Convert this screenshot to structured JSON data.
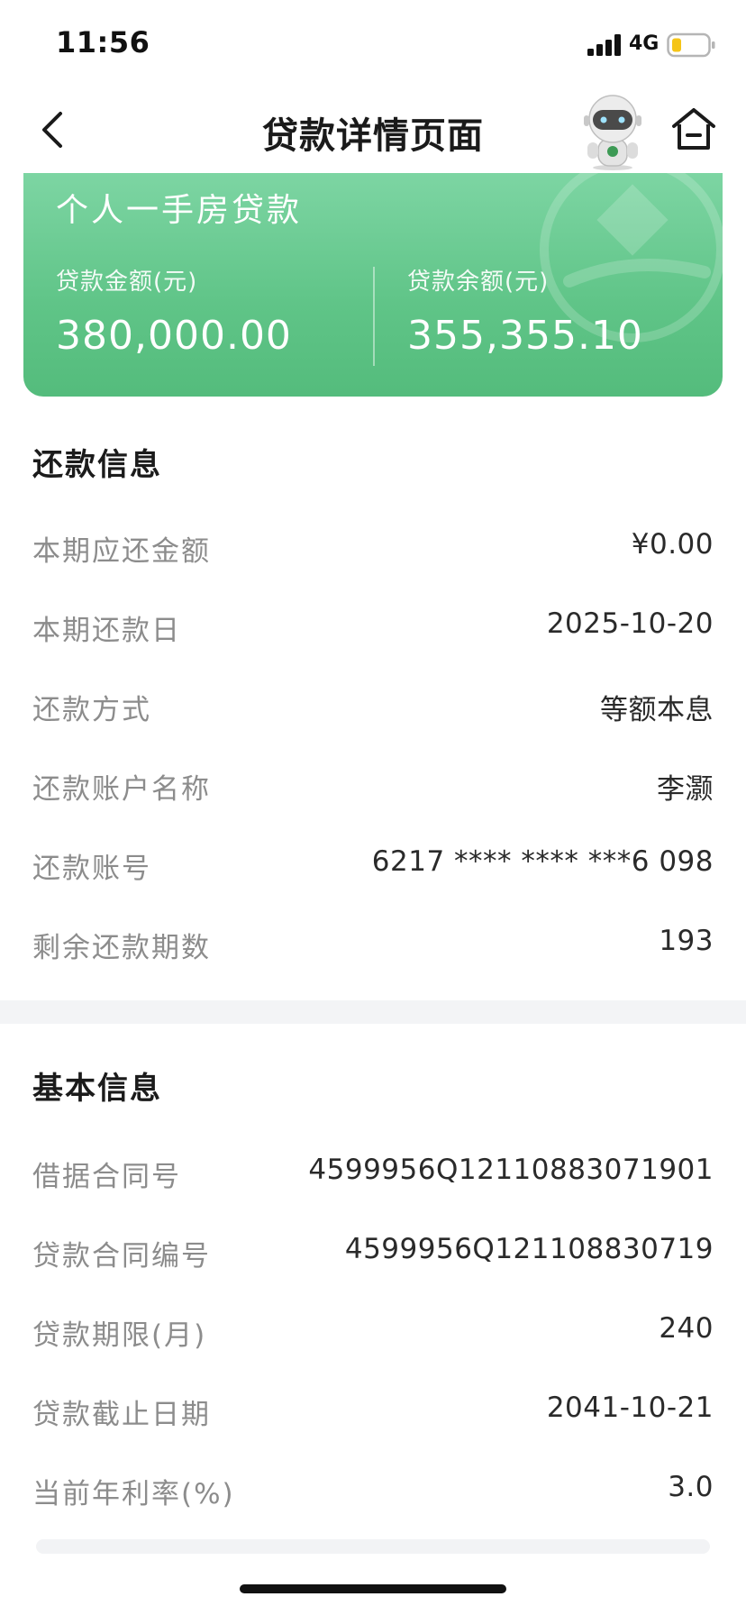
{
  "status_bar": {
    "time": "11:56",
    "network": "4G"
  },
  "nav": {
    "title": "贷款详情页面",
    "back_icon": "chevron-left-icon",
    "assistant_icon": "robot-assistant-icon",
    "home_icon": "home-icon"
  },
  "loan_card": {
    "loan_type": "个人一手房贷款",
    "loan_amount_label": "贷款金额(元)",
    "loan_amount_value": "380,000.00",
    "loan_balance_label": "贷款余额(元)",
    "loan_balance_value": "355,355.10",
    "accent_color": "#5fc487"
  },
  "repayment_info": {
    "title": "还款信息",
    "rows": [
      {
        "label": "本期应还金额",
        "value": "¥0.00"
      },
      {
        "label": "本期还款日",
        "value": "2025-10-20"
      },
      {
        "label": "还款方式",
        "value": "等额本息"
      },
      {
        "label": "还款账户名称",
        "value": "李灏"
      },
      {
        "label": "还款账号",
        "value": "6217 **** **** ***6 098"
      },
      {
        "label": "剩余还款期数",
        "value": "193"
      }
    ]
  },
  "basic_info": {
    "title": "基本信息",
    "rows": [
      {
        "label": "借据合同号",
        "value": "4599956Q12110883071901"
      },
      {
        "label": "贷款合同编号",
        "value": "4599956Q121108830719"
      },
      {
        "label": "贷款期限(月)",
        "value": "240"
      },
      {
        "label": "贷款截止日期",
        "value": "2041-10-21"
      },
      {
        "label": "当前年利率(%)",
        "value": "3.0"
      }
    ]
  }
}
